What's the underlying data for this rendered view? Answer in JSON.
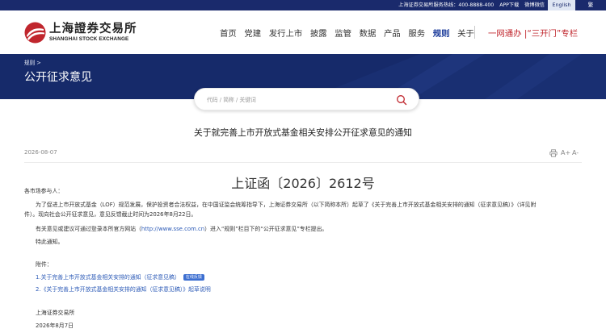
{
  "topbar": {
    "hotline": "上海证券交易所服务热线：400-8888-400",
    "app_download": "APP下载",
    "weibo_wechat": "微博微信",
    "lang_english": "English",
    "lang_traditional": "繁"
  },
  "logo": {
    "cn": "上海證券交易所",
    "en": "SHANGHAI STOCK EXCHANGE"
  },
  "nav": {
    "items": [
      "首页",
      "党建",
      "发行上市",
      "披露",
      "监管",
      "数据",
      "产品",
      "服务",
      "规则",
      "关于"
    ],
    "active_index": 8,
    "promo": "一网通办 |“三开门”专栏"
  },
  "banner": {
    "breadcrumb": "规则 >",
    "title": "公开征求意见"
  },
  "search": {
    "placeholder": "代码 / 简称 / 关键词"
  },
  "article": {
    "title": "关于就完善上市开放式基金相关安排公开征求意见的通知",
    "date": "2026-08-07",
    "tools": {
      "print": "print-icon",
      "font_increase": "A+",
      "font_decrease": "A-"
    },
    "ref_number": "上证函〔2026〕2612号",
    "salutation": "各市场参与人：",
    "para1_line1": "为了促进上市开放式基金（LOF）规范发展，保护投资者合法权益，在中国证监会统筹指导下，上海证券交易所（以下简称本所）起草了《关于完善上市开放式基金相关安排的通知（征求意见稿）》（详见附",
    "para1_line2": "件）。现向社会公开征求意见，意见反馈截止时间为2026年8月22日。",
    "para2_a": "有关意见或建议可通过登录本所官方网站（",
    "para2_link": "http://www.sse.com.cn",
    "para2_b": "）进入“规则”栏目下的“公开征求意见”专栏提出。",
    "closing": "特此通知。",
    "attachments_label": "附件：",
    "attachments": [
      {
        "text": "1.关于完善上市开放式基金相关安排的通知（征求意见稿）",
        "badge": "在线反馈"
      },
      {
        "text": "2.《关于完善上市开放式基金相关安排的通知（征求意见稿）》起草说明"
      }
    ],
    "signature": "上海证券交易所",
    "sign_date": "2026年8月7日"
  },
  "colors": {
    "navy": "#1a2a6c",
    "accent_red": "#c0262d",
    "link_blue": "#2d5bb7"
  }
}
